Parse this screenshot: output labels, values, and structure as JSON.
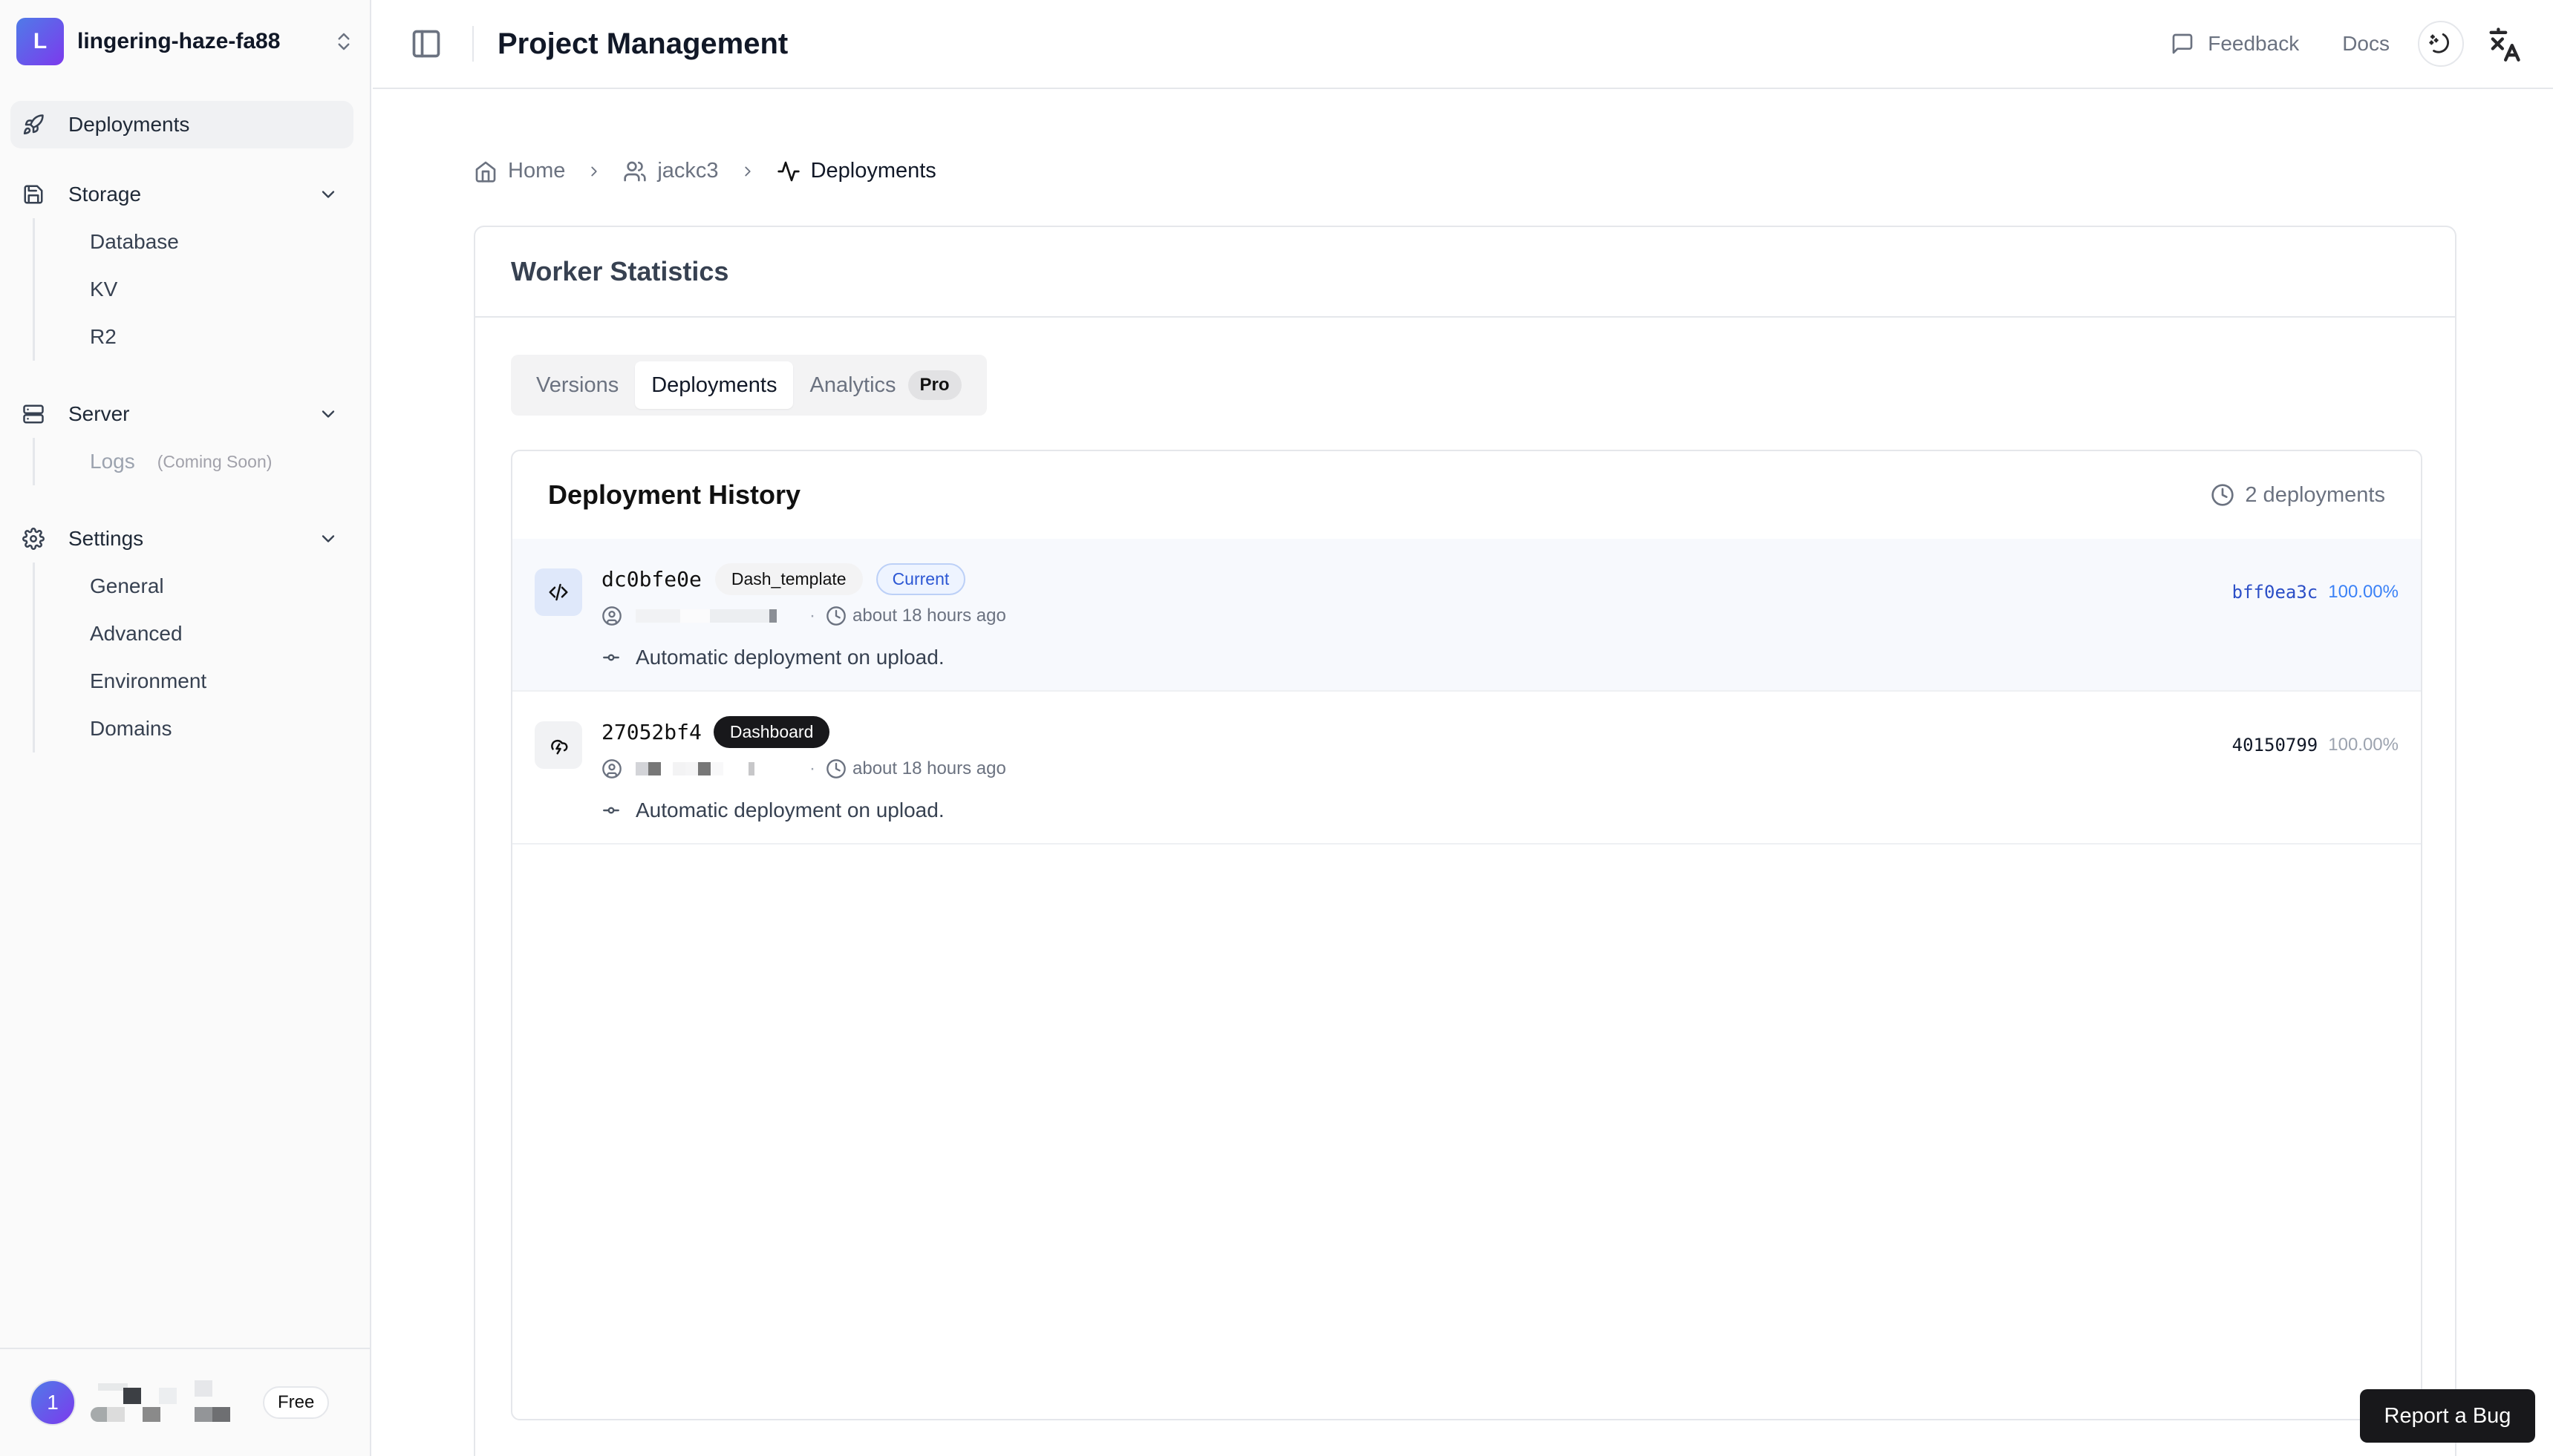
{
  "team": {
    "initial": "L",
    "name": "lingering-haze-fa88"
  },
  "sidebar": {
    "primary": {
      "label": "Deployments",
      "icon": "rocket-icon"
    },
    "groups": [
      {
        "label": "Storage",
        "icon": "save-icon",
        "items": [
          {
            "label": "Database"
          },
          {
            "label": "KV"
          },
          {
            "label": "R2"
          }
        ]
      },
      {
        "label": "Server",
        "icon": "server-icon",
        "items": [
          {
            "label": "Logs",
            "note": "(Coming Soon)",
            "disabled": true
          }
        ]
      },
      {
        "label": "Settings",
        "icon": "gear-icon",
        "items": [
          {
            "label": "General"
          },
          {
            "label": "Advanced"
          },
          {
            "label": "Environment"
          },
          {
            "label": "Domains"
          }
        ]
      }
    ],
    "user": {
      "avatar_initial": "1",
      "name": "[redacted]",
      "plan": "Free"
    }
  },
  "topbar": {
    "title": "Project Management",
    "feedback_label": "Feedback",
    "docs_label": "Docs"
  },
  "breadcrumb": [
    {
      "label": "Home",
      "icon": "home-icon"
    },
    {
      "label": "jackc3",
      "icon": "users-icon"
    },
    {
      "label": "Deployments",
      "icon": "activity-icon"
    }
  ],
  "card": {
    "title": "Worker Statistics",
    "tabs": [
      {
        "label": "Versions",
        "active": false
      },
      {
        "label": "Deployments",
        "active": true
      },
      {
        "label": "Analytics",
        "active": false,
        "badge": "Pro"
      }
    ]
  },
  "history": {
    "title": "Deployment History",
    "count_label": "2 deployments",
    "rows": [
      {
        "id": "dc0bfe0e",
        "tag": "Dash_template",
        "status": "Current",
        "author": "[redacted]",
        "time": "about 18 hours ago",
        "message": "Automatic deployment on upload.",
        "version_id": "bff0ea3c",
        "percentage": "100.00%",
        "icon": "code-icon"
      },
      {
        "id": "27052bf4",
        "tag": "Dashboard",
        "author": "[redacted]",
        "time": "about 18 hours ago",
        "message": "Automatic deployment on upload.",
        "version_id": "40150799",
        "percentage": "100.00%",
        "icon": "cloud-lightning-icon"
      }
    ]
  },
  "report_bug_label": "Report a Bug",
  "colors": {
    "accent": "#2c57d4",
    "brand_gradient_start": "#4f7be8",
    "brand_gradient_end": "#7c3aed"
  }
}
